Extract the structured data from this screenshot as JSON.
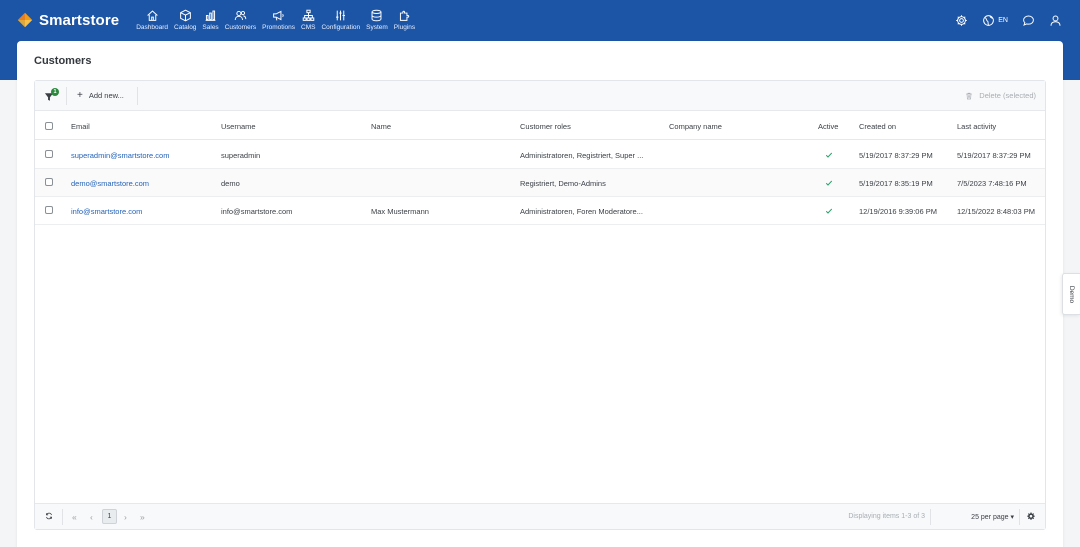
{
  "brand": {
    "name": "Smartstore"
  },
  "nav": {
    "items": [
      {
        "label": "Dashboard",
        "icon": "home-icon"
      },
      {
        "label": "Catalog",
        "icon": "box-icon"
      },
      {
        "label": "Sales",
        "icon": "chart-icon"
      },
      {
        "label": "Customers",
        "icon": "users-icon"
      },
      {
        "label": "Promotions",
        "icon": "megaphone-icon"
      },
      {
        "label": "CMS",
        "icon": "sitemap-icon"
      },
      {
        "label": "Configuration",
        "icon": "sliders-icon"
      },
      {
        "label": "System",
        "icon": "database-icon"
      },
      {
        "label": "Plugins",
        "icon": "puzzle-icon"
      }
    ],
    "language": "EN"
  },
  "page": {
    "title": "Customers"
  },
  "toolbar": {
    "filter_count": "1",
    "add_label": "Add new...",
    "delete_label": "Delete (selected)"
  },
  "table": {
    "columns": [
      "Email",
      "Username",
      "Name",
      "Customer roles",
      "Company name",
      "Active",
      "Created on",
      "Last activity"
    ],
    "rows": [
      {
        "email": "superadmin@smartstore.com",
        "username": "superadmin",
        "name": "",
        "roles": "Administratoren, Registriert, Super ...",
        "company": "",
        "active": true,
        "created": "5/19/2017 8:37:29 PM",
        "last_activity": "5/19/2017 8:37:29 PM"
      },
      {
        "email": "demo@smartstore.com",
        "username": "demo",
        "name": "",
        "roles": "Registriert, Demo-Admins",
        "company": "",
        "active": true,
        "created": "5/19/2017 8:35:19 PM",
        "last_activity": "7/5/2023 7:48:16 PM"
      },
      {
        "email": "info@smartstore.com",
        "username": "info@smartstore.com",
        "name": "Max Mustermann",
        "roles": "Administratoren, Foren Moderatore...",
        "company": "",
        "active": true,
        "created": "12/19/2016 9:39:06 PM",
        "last_activity": "12/15/2022 8:48:03 PM"
      }
    ]
  },
  "pager": {
    "first": "«",
    "prev": "‹",
    "current": "1",
    "next": "›",
    "last": "»",
    "info": "Displaying items 1-3 of 3",
    "page_size": "25 per page ▾"
  },
  "side_tab": {
    "label": "Demo"
  },
  "colors": {
    "header": "#1c55a6",
    "link": "#2563b8",
    "active_check": "#2f9e6b",
    "badge": "#2b8a3e"
  }
}
